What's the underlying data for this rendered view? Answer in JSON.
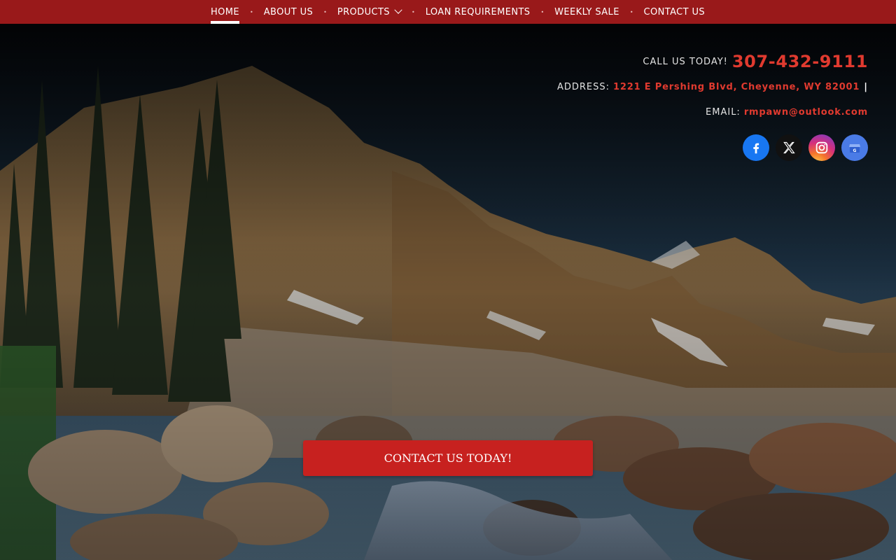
{
  "nav": {
    "items": [
      {
        "label": "HOME",
        "active": true
      },
      {
        "label": "ABOUT US"
      },
      {
        "label": "PRODUCTS",
        "has_dropdown": true
      },
      {
        "label": "LOAN REQUIREMENTS"
      },
      {
        "label": "WEEKLY SALE"
      },
      {
        "label": "CONTACT US"
      }
    ]
  },
  "contact": {
    "call_label": "CALL US TODAY!",
    "phone": "307-432-9111",
    "address_label": "ADDRESS:",
    "address": "1221 E Pershing Blvd, Cheyenne, WY 82001",
    "address_sep": "|",
    "email_label": "EMAIL:",
    "email": "rmpawn@outlook.com"
  },
  "social": {
    "icons": [
      "facebook-icon",
      "x-twitter-icon",
      "instagram-icon",
      "google-business-icon"
    ]
  },
  "cta": {
    "label": "CONTACT US TODAY!"
  },
  "colors": {
    "nav_bg": "#99191a",
    "accent_red": "#e03a2f",
    "cta_bg": "#c7211f"
  }
}
